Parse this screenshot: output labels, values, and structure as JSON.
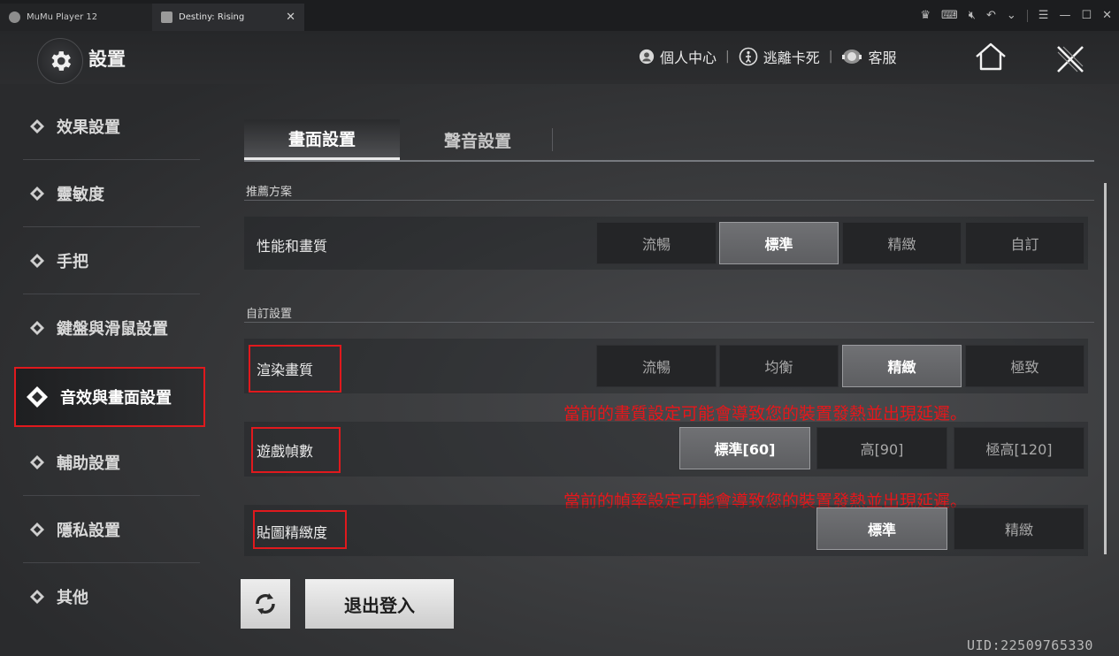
{
  "host": {
    "tabs": [
      {
        "label": "MuMu Player 12"
      },
      {
        "label": "Destiny: Rising",
        "close": "✕"
      }
    ]
  },
  "header": {
    "title": "設置",
    "links": [
      {
        "label": "個人中心",
        "icon": "user-icon"
      },
      {
        "label": "逃離卡死",
        "icon": "escape-icon"
      },
      {
        "label": "客服",
        "icon": "headset-icon"
      }
    ],
    "divider": "|"
  },
  "sidebar": {
    "items": [
      {
        "label": "效果設置"
      },
      {
        "label": "靈敏度"
      },
      {
        "label": "手把"
      },
      {
        "label": "鍵盤與滑鼠設置"
      },
      {
        "label": "音效與畫面設置",
        "active": true
      },
      {
        "label": "輔助設置"
      },
      {
        "label": "隱私設置"
      },
      {
        "label": "其他"
      }
    ]
  },
  "main": {
    "tabs": [
      {
        "label": "畫面設置",
        "active": true
      },
      {
        "label": "聲音設置"
      }
    ],
    "preset_section": "推薦方案",
    "preset": {
      "label": "性能和畫質",
      "options": [
        "流暢",
        "標準",
        "精緻",
        "自訂"
      ],
      "selected": "標準"
    },
    "custom_section": "自訂設置",
    "render_quality": {
      "label": "渲染畫質",
      "options": [
        "流暢",
        "均衡",
        "精緻",
        "極致"
      ],
      "selected": "精緻",
      "warning": "當前的畫質設定可能會導致您的裝置發熱並出現延遲。"
    },
    "frame_rate": {
      "label": "遊戲幀數",
      "options": [
        "標準[60]",
        "高[90]",
        "極高[120]"
      ],
      "selected": "標準[60]",
      "warning": "當前的幀率設定可能會導致您的裝置發熱並出現延遲。"
    },
    "texture": {
      "label": "貼圖精緻度",
      "options": [
        "標準",
        "精緻"
      ],
      "selected": "標準"
    }
  },
  "footer": {
    "logout": "退出登入",
    "uid": "UID:22509765330"
  },
  "colors": {
    "highlight_red": "#e0191d",
    "warning_red": "#e8161a"
  }
}
